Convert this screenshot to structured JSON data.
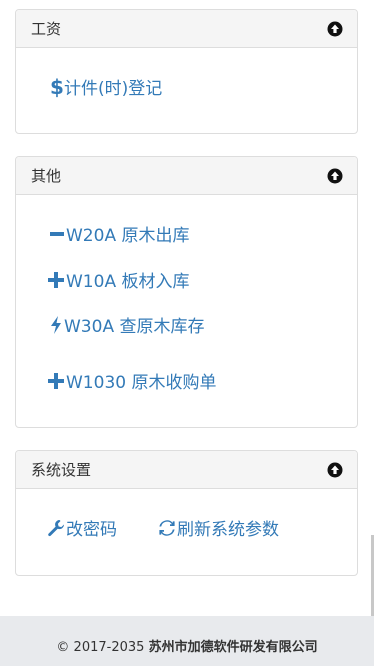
{
  "panels": {
    "wages": {
      "title": "工资",
      "links": [
        {
          "label": "计件(时)登记",
          "icon": "dollar-icon"
        }
      ]
    },
    "other": {
      "title": "其他",
      "links": [
        {
          "label": "W20A 原木出库",
          "icon": "minus-icon"
        },
        {
          "label": "W10A 板材入库",
          "icon": "plus-icon"
        },
        {
          "label": "W30A 查原木库存",
          "icon": "flash-icon"
        },
        {
          "label": "W1030 原木收购单",
          "icon": "plus-icon"
        }
      ]
    },
    "settings": {
      "title": "系统设置",
      "links": [
        {
          "label": "改密码",
          "icon": "wrench-icon"
        },
        {
          "label": "刷新系统参数",
          "icon": "refresh-icon"
        }
      ]
    }
  },
  "footer": {
    "copyright": "© 2017-2035",
    "company": "苏州市加德软件研发有限公司"
  },
  "colors": {
    "link": "#337ab7",
    "heading_bg": "#f5f5f5",
    "border": "#dddddd",
    "footer_bg": "#e8eaed"
  }
}
